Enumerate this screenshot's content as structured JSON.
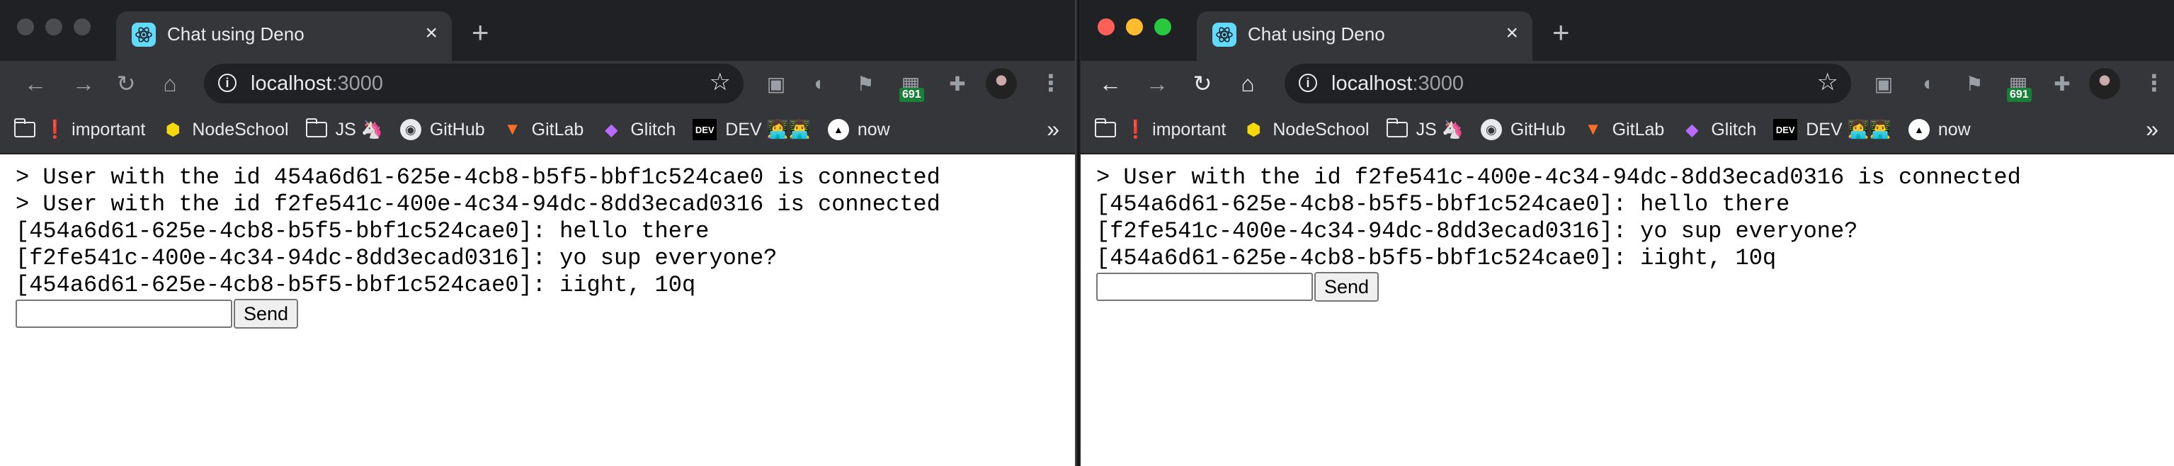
{
  "browser": {
    "tab_title": "Chat using Deno",
    "tab_close": "×",
    "new_tab": "+",
    "url_host": "localhost",
    "url_port": ":3000",
    "nav": {
      "back": "←",
      "forward": "→",
      "reload": "↻",
      "home": "⌂"
    },
    "extension_badge": "691",
    "bookmarks": [
      {
        "icon": "folder-icon",
        "label": "important",
        "prefix": "❗"
      },
      {
        "icon": "hexagon-icon",
        "label": "NodeSchool"
      },
      {
        "icon": "folder-icon",
        "label": "JS",
        "suffix": "🦄"
      },
      {
        "icon": "github-icon",
        "label": "GitHub"
      },
      {
        "icon": "gitlab-icon",
        "label": "GitLab"
      },
      {
        "icon": "glitch-icon",
        "label": "Glitch"
      },
      {
        "icon": "dev-icon",
        "label": "DEV",
        "suffix": "👩‍💻👨‍💻"
      },
      {
        "icon": "now-icon",
        "label": "now"
      }
    ],
    "bookmarks_more": "»",
    "accent_colors": {
      "tab_icon": "#61dafb",
      "traffic_red": "#fe5f57",
      "traffic_yellow": "#febc2e",
      "traffic_green": "#28c840"
    }
  },
  "left_window": {
    "messages": [
      "> User with the id 454a6d61-625e-4cb8-b5f5-bbf1c524cae0 is connected",
      "> User with the id f2fe541c-400e-4c34-94dc-8dd3ecad0316 is connected",
      "[454a6d61-625e-4cb8-b5f5-bbf1c524cae0]: hello there",
      "[f2fe541c-400e-4c34-94dc-8dd3ecad0316]: yo sup everyone?",
      "[454a6d61-625e-4cb8-b5f5-bbf1c524cae0]: iight, 10q"
    ],
    "input_value": "",
    "send_label": "Send"
  },
  "right_window": {
    "messages": [
      "> User with the id f2fe541c-400e-4c34-94dc-8dd3ecad0316 is connected",
      "[454a6d61-625e-4cb8-b5f5-bbf1c524cae0]: hello there",
      "[f2fe541c-400e-4c34-94dc-8dd3ecad0316]: yo sup everyone?",
      "[454a6d61-625e-4cb8-b5f5-bbf1c524cae0]: iight, 10q"
    ],
    "input_value": "",
    "send_label": "Send"
  }
}
